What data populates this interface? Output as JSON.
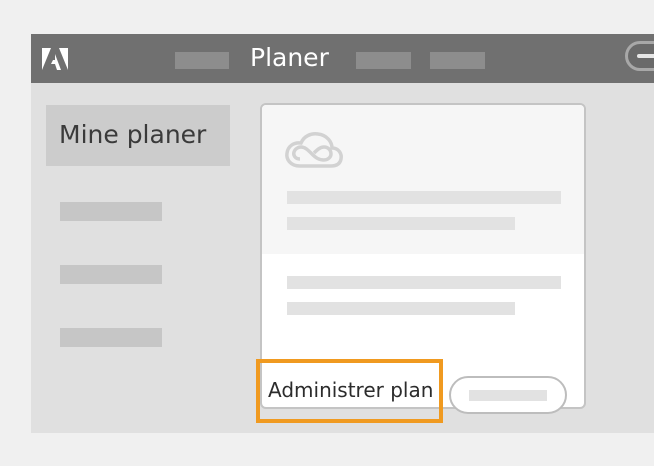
{
  "header": {
    "app_title": "Planer",
    "logo": "adobe-logo-icon"
  },
  "sidebar": {
    "selected_label": "Mine planer"
  },
  "plan_card": {
    "icon": "creative-cloud-icon",
    "manage_label": "Administrer plan"
  },
  "colors": {
    "topbar": "#707070",
    "highlight": "#f09a20",
    "sidebar_selected": "#cccccc"
  }
}
